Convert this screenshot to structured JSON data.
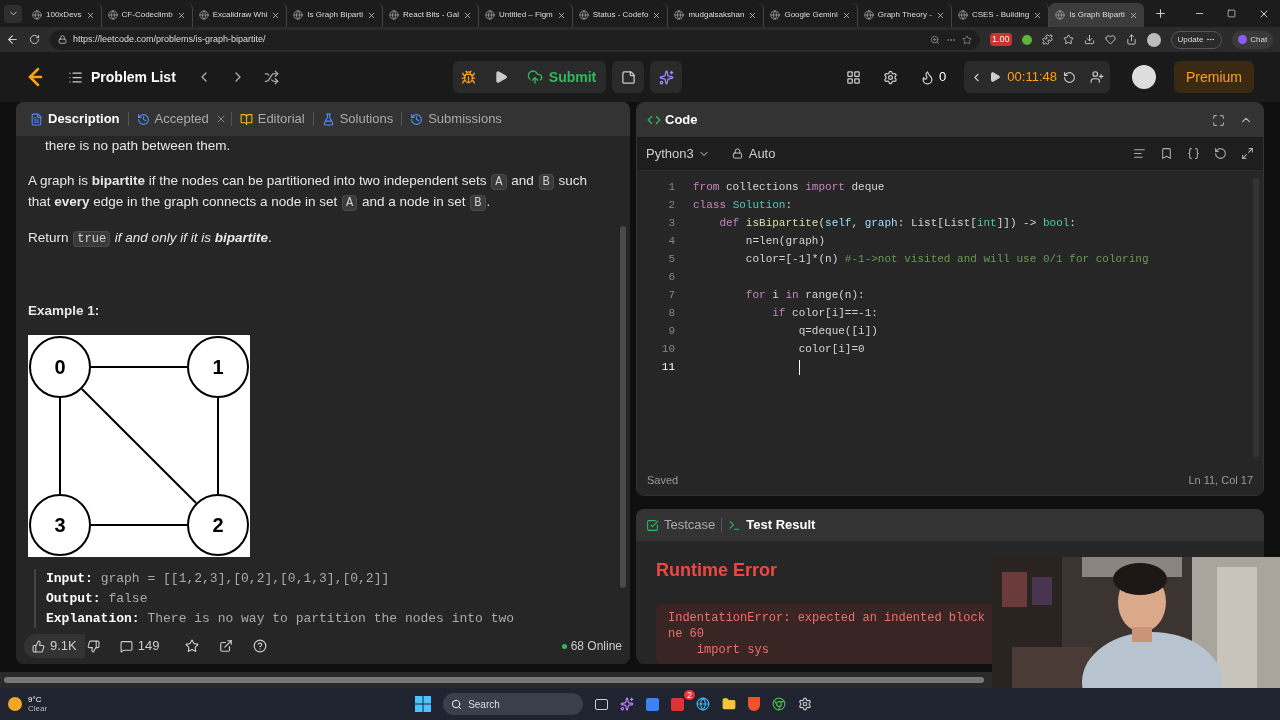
{
  "browser": {
    "tabs": [
      {
        "title": "100xDevs",
        "selected": false
      },
      {
        "title": "CF-Codeclimb",
        "selected": false
      },
      {
        "title": "Excalidraw Whi",
        "selected": false
      },
      {
        "title": "Is Graph Biparti",
        "selected": false
      },
      {
        "title": "React Bits - Gal",
        "selected": false
      },
      {
        "title": "Untitled – Figm",
        "selected": false
      },
      {
        "title": "Status - Codefo",
        "selected": false
      },
      {
        "title": "mudgalsakshan",
        "selected": false
      },
      {
        "title": "Google Gemini",
        "selected": false
      },
      {
        "title": "Graph Theory -",
        "selected": false
      },
      {
        "title": "CSES - Building",
        "selected": false
      },
      {
        "title": "Is Graph Biparti",
        "selected": true
      }
    ],
    "url": "https://leetcode.com/problems/is-graph-bipartite/",
    "extension_badge": "1.00",
    "update_label": "Update",
    "chat_label": "Chat"
  },
  "nav": {
    "problem_list": "Problem List",
    "submit": "Submit",
    "streak": "0",
    "timer": "00:11:48",
    "premium": "Premium"
  },
  "left_tabs": [
    {
      "label": "Description",
      "selected": true
    },
    {
      "label": "Accepted",
      "selected": false
    },
    {
      "label": "Editorial",
      "selected": false
    },
    {
      "label": "Solutions",
      "selected": false
    },
    {
      "label": "Submissions",
      "selected": false
    }
  ],
  "description": {
    "top_line": "there is no path between them.",
    "paragraphs": [
      [
        {
          "kind": "text",
          "text": "A graph is **bipartite** if the nodes can be partitioned into two independent sets "
        },
        {
          "kind": "code",
          "text": "A"
        },
        {
          "kind": "text",
          "text": " and "
        },
        {
          "kind": "code",
          "text": "B"
        },
        {
          "kind": "text",
          "text": " such that **every** edge in the graph connects a node in set "
        },
        {
          "kind": "code",
          "text": "A"
        },
        {
          "kind": "text",
          "text": " and a node in set "
        },
        {
          "kind": "code",
          "text": "B"
        },
        {
          "kind": "text",
          "text": "."
        }
      ],
      [
        {
          "kind": "text",
          "text": "Return "
        },
        {
          "kind": "code",
          "text": "true"
        },
        {
          "kind": "italic",
          "text": " if and only if it is **bipartite**"
        },
        {
          "kind": "text",
          "text": "."
        }
      ]
    ],
    "example_title": "Example 1:",
    "nodes": [
      "0",
      "1",
      "3",
      "2"
    ],
    "example_lines": [
      {
        "label": "Input:",
        "value": "graph = [[1,2,3],[0,2],[0,1,3],[0,2]]"
      },
      {
        "label": "Output:",
        "value": "false"
      },
      {
        "label": "Explanation:",
        "value": "There is no way to partition the nodes into two"
      }
    ]
  },
  "left_footer": {
    "likes": "9.1K",
    "comments": "149",
    "online": "68 Online"
  },
  "code_panel": {
    "title": "Code",
    "language": "Python3",
    "mode": "Auto",
    "status": "Saved",
    "cursor_pos": "Ln 11, Col 17",
    "lines": [
      {
        "number": "1",
        "tokens": [
          {
            "kind": "keyword",
            "text": "from"
          },
          {
            "kind": "plain",
            "text": " collections "
          },
          {
            "kind": "keyword",
            "text": "import"
          },
          {
            "kind": "plain",
            "text": " deque"
          }
        ]
      },
      {
        "number": "2",
        "tokens": [
          {
            "kind": "keyword",
            "text": "class"
          },
          {
            "kind": "type",
            "text": " Solution"
          },
          {
            "kind": "plain",
            "text": ":"
          }
        ]
      },
      {
        "number": "3",
        "tokens": [
          {
            "kind": "keyword",
            "text": "    def"
          },
          {
            "kind": "function",
            "text": " isBipartite"
          },
          {
            "kind": "plain",
            "text": "("
          },
          {
            "kind": "param",
            "text": "self"
          },
          {
            "kind": "plain",
            "text": ", "
          },
          {
            "kind": "param",
            "text": "graph"
          },
          {
            "kind": "plain",
            "text": ": List[List["
          },
          {
            "kind": "type",
            "text": "int"
          },
          {
            "kind": "plain",
            "text": "]]) -> "
          },
          {
            "kind": "type",
            "text": "bool"
          },
          {
            "kind": "plain",
            "text": ":"
          }
        ]
      },
      {
        "number": "4",
        "tokens": [
          {
            "kind": "plain",
            "text": "        n=len(graph)"
          }
        ]
      },
      {
        "number": "5",
        "tokens": [
          {
            "kind": "plain",
            "text": "        color=[-1]*(n) "
          },
          {
            "kind": "comment",
            "text": "#-1->not visited and will use 0/1 for coloring"
          }
        ]
      },
      {
        "number": "6"
      },
      {
        "number": "7",
        "tokens": [
          {
            "kind": "keyword",
            "text": "        for"
          },
          {
            "kind": "plain",
            "text": " i "
          },
          {
            "kind": "keyword",
            "text": "in"
          },
          {
            "kind": "plain",
            "text": " range(n):"
          }
        ]
      },
      {
        "number": "8",
        "tokens": [
          {
            "kind": "keyword",
            "text": "            if"
          },
          {
            "kind": "plain",
            "text": " color[i]==-1:"
          }
        ]
      },
      {
        "number": "9",
        "tokens": [
          {
            "kind": "plain",
            "text": "                q=deque([i])"
          }
        ]
      },
      {
        "number": "10",
        "tokens": [
          {
            "kind": "plain",
            "text": "                color[i]=0"
          }
        ]
      },
      {
        "number": "11",
        "cursor": true
      }
    ]
  },
  "test_panel": {
    "tabs": [
      {
        "label": "Testcase",
        "selected": false
      },
      {
        "label": "Test Result",
        "selected": true
      }
    ],
    "result_title": "Runtime Error",
    "error_lines": [
      "IndentationError: expected an indented block",
      "ne 60",
      "    import sys"
    ]
  },
  "taskbar": {
    "temperature": "9°C",
    "weather": "Clear",
    "search": "Search",
    "mail_badge": "2"
  }
}
